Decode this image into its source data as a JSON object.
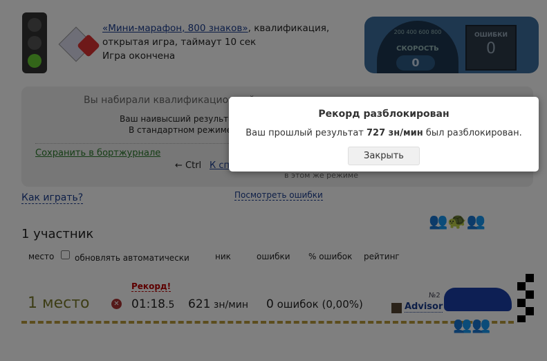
{
  "header": {
    "game_link": "«Мини-марафон, 800 знаков»",
    "game_desc_1": ", квалификация,",
    "game_desc_2": "открытая игра, таймаут 10 сек",
    "status": "Игра окончена"
  },
  "dashboard": {
    "speed_label": "СКОРОСТЬ",
    "speed_value": "0",
    "errors_label": "ОШИБКИ",
    "errors_value": "0",
    "ticks": [
      "200",
      "400",
      "600",
      "800"
    ]
  },
  "result_box": {
    "heading": "Вы набирали квалификационный",
    "best_line": "Ваш наивысший результат",
    "standard_line": "В стандартном режиме з",
    "save_link": "Сохранить в бортжурнале",
    "ctrl_hint": "← Ctrl",
    "back_link": "К сп",
    "same_mode": "в этом же режиме"
  },
  "links": {
    "how_to_play": "Как играть?",
    "view_errors": "Посмотреть ошибки"
  },
  "participants": {
    "title": "1 участник",
    "columns": {
      "place": "место",
      "auto_update": "обновлять автоматически",
      "nick": "ник",
      "errors": "ошибки",
      "error_pct": "% ошибок",
      "rating": "рейтинг"
    }
  },
  "row": {
    "place": "1 место",
    "record": "Рекорд!",
    "time_main": "01:18",
    "time_frac": ".5",
    "speed": "621",
    "speed_unit": " зн/мин",
    "errors": "0",
    "errors_text": " ошибок (0,00%)",
    "car_no": "№2",
    "nick": "Advisor"
  },
  "modal": {
    "title": "Рекорд разблокирован",
    "text_before": "Ваш прошлый результат ",
    "value": "727 зн/мин",
    "text_after": " был разблокирован.",
    "close": "Закрыть"
  }
}
